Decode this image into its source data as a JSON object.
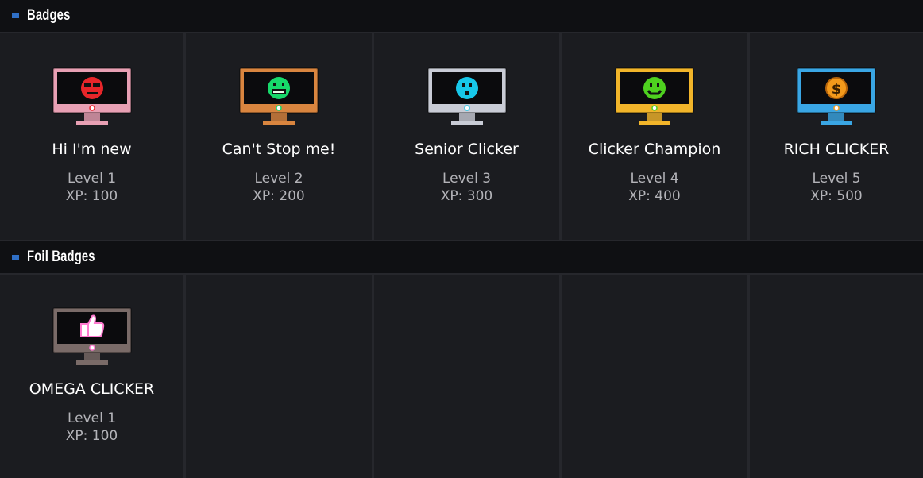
{
  "sections": [
    {
      "title": "Badges",
      "badges": [
        {
          "name": "Hi I'm new",
          "level": "Level 1",
          "xp": "XP: 100",
          "icon": "monitor-red-cool-face-icon",
          "frame": "#e8a0b4",
          "face": "#e8262a"
        },
        {
          "name": "Can't Stop me!",
          "level": "Level 2",
          "xp": "XP: 200",
          "icon": "monitor-green-grin-face-icon",
          "frame": "#d9853f",
          "face": "#17d96a"
        },
        {
          "name": "Senior Clicker",
          "level": "Level 3",
          "xp": "XP: 300",
          "icon": "monitor-cyan-surprised-face-icon",
          "frame": "#c9ccd6",
          "face": "#17c8ea"
        },
        {
          "name": "Clicker Champion",
          "level": "Level 4",
          "xp": "XP: 400",
          "icon": "monitor-lime-smile-face-icon",
          "frame": "#f2b52a",
          "face": "#4ed11f"
        },
        {
          "name": "RICH CLICKER",
          "level": "Level 5",
          "xp": "XP: 500",
          "icon": "monitor-gold-dollar-coin-icon",
          "frame": "#3aa6e4",
          "face": "#f39a1b"
        }
      ]
    },
    {
      "title": "Foil Badges",
      "badges": [
        {
          "name": "OMEGA CLICKER",
          "level": "Level 1",
          "xp": "XP: 100",
          "icon": "monitor-thumbs-up-foil-icon",
          "frame": "#7a6b68",
          "face": "#ff7ad0"
        }
      ]
    }
  ],
  "colors": {
    "background": "#1b1c20",
    "header": "#0f1013",
    "accent": "#2f6fc6"
  }
}
